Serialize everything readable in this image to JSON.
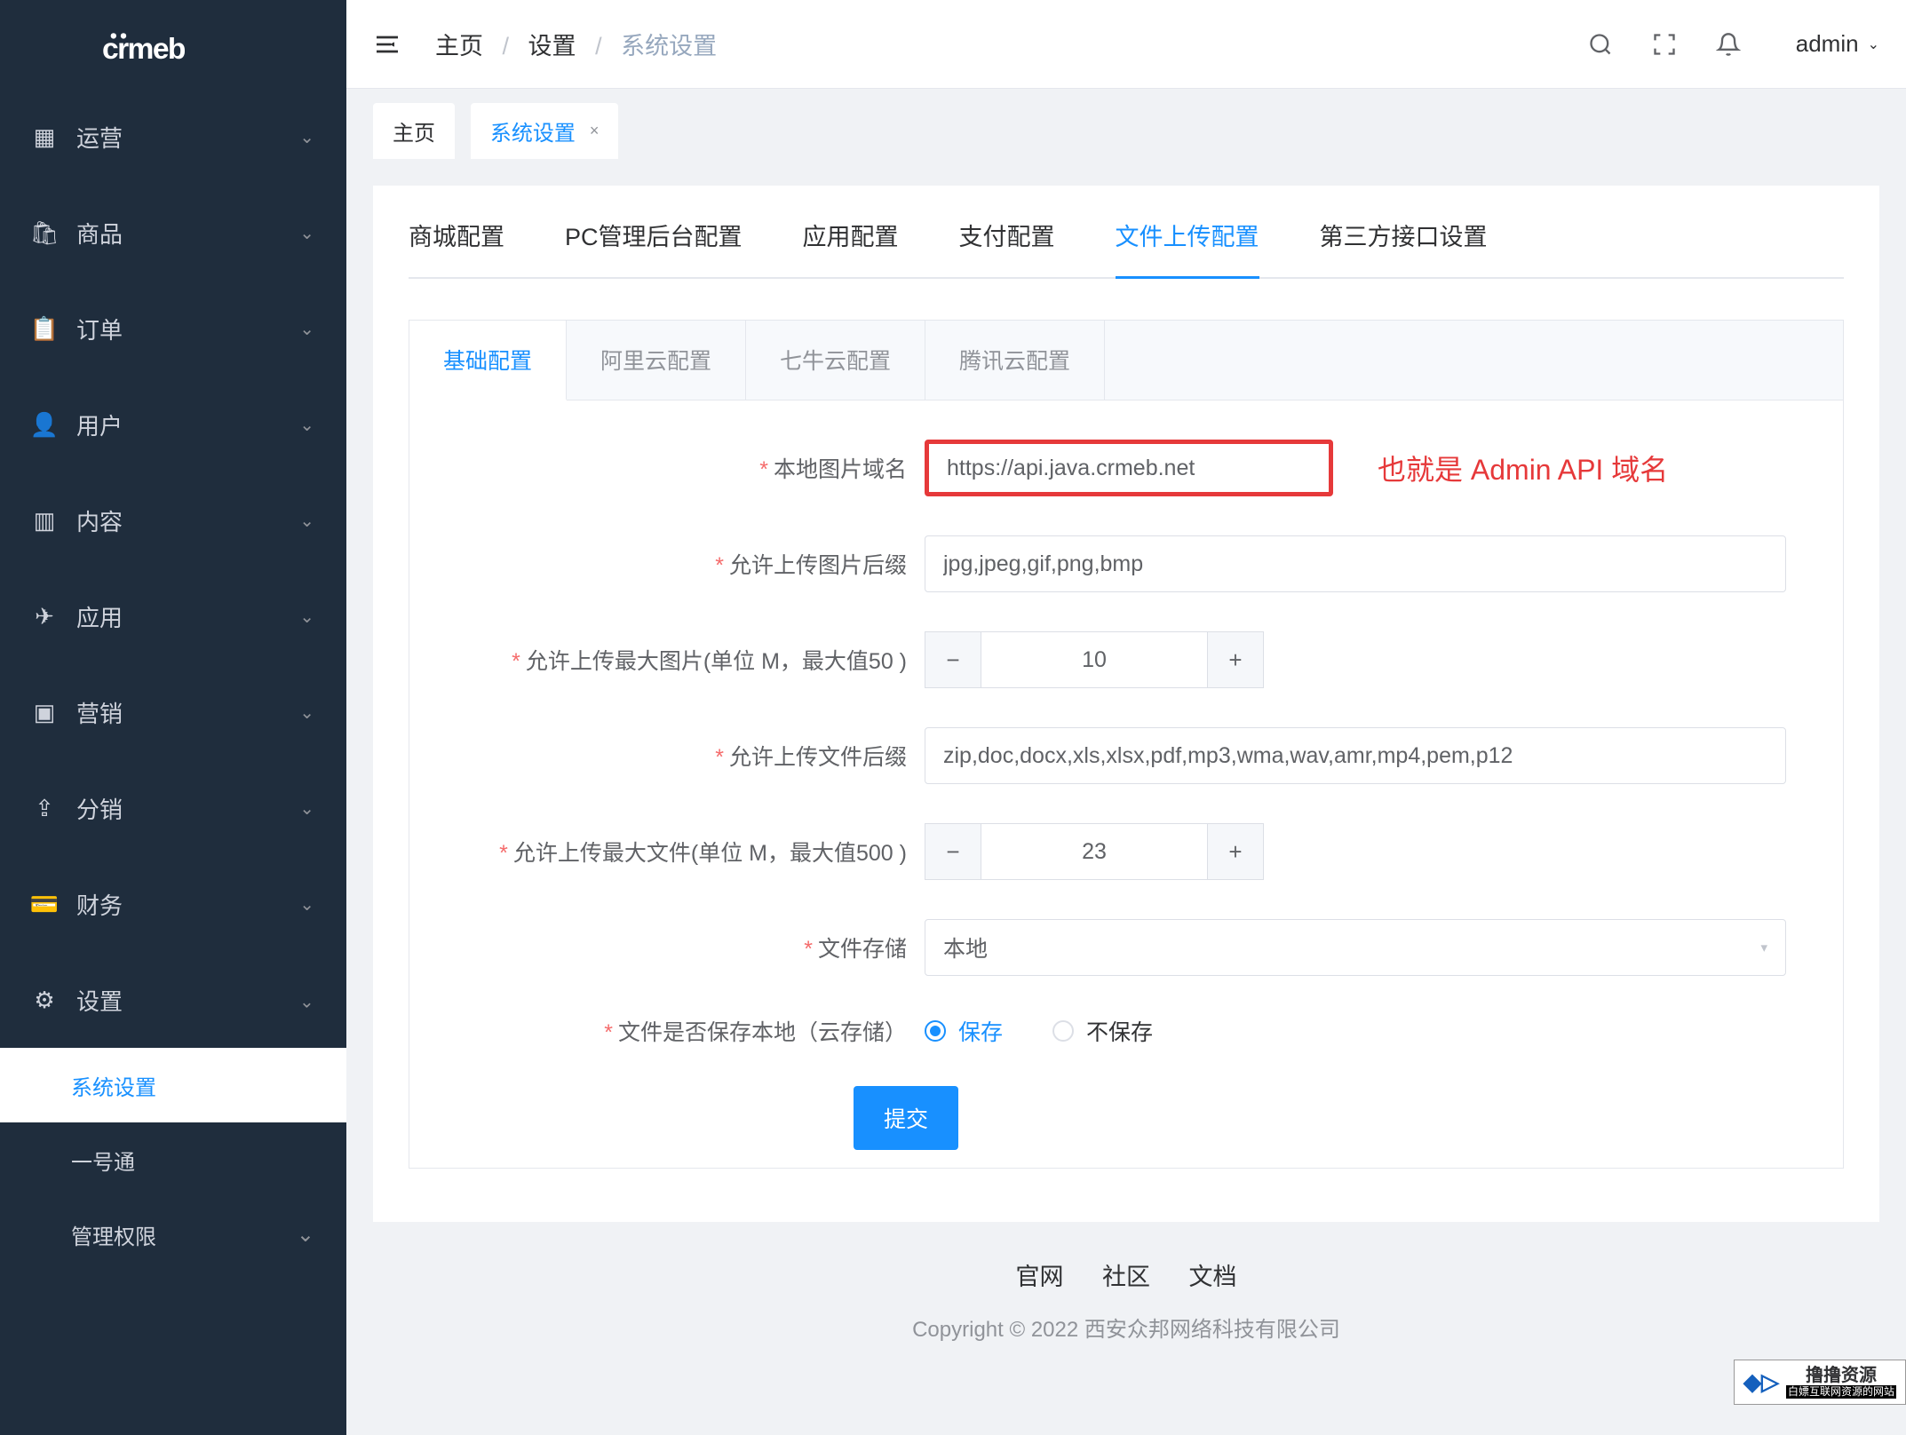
{
  "logo": "crmeb",
  "sidebar": {
    "items": [
      {
        "label": "运营",
        "icon": "grid"
      },
      {
        "label": "商品",
        "icon": "bag"
      },
      {
        "label": "订单",
        "icon": "clipboard"
      },
      {
        "label": "用户",
        "icon": "user"
      },
      {
        "label": "内容",
        "icon": "columns"
      },
      {
        "label": "应用",
        "icon": "plane"
      },
      {
        "label": "营销",
        "icon": "chart"
      },
      {
        "label": "分销",
        "icon": "share"
      },
      {
        "label": "财务",
        "icon": "wallet"
      },
      {
        "label": "设置",
        "icon": "gear",
        "expanded": true
      }
    ],
    "submenu": [
      {
        "label": "系统设置",
        "active": true
      },
      {
        "label": "一号通"
      },
      {
        "label": "管理权限"
      }
    ]
  },
  "header": {
    "breadcrumb": [
      "主页",
      "设置",
      "系统设置"
    ],
    "username": "admin"
  },
  "tabs_bar": [
    {
      "label": "主页"
    },
    {
      "label": "系统设置",
      "active": true,
      "closable": true
    }
  ],
  "main_tabs": [
    "商城配置",
    "PC管理后台配置",
    "应用配置",
    "支付配置",
    "文件上传配置",
    "第三方接口设置"
  ],
  "main_tab_active": 4,
  "sub_tabs": [
    "基础配置",
    "阿里云配置",
    "七牛云配置",
    "腾讯云配置"
  ],
  "sub_tab_active": 0,
  "form": {
    "local_image_domain": {
      "label": "本地图片域名",
      "value": "https://api.java.crmeb.net"
    },
    "annotation": "也就是 Admin API 域名",
    "allowed_image_ext": {
      "label": "允许上传图片后缀",
      "value": "jpg,jpeg,gif,png,bmp"
    },
    "max_image_size": {
      "label": "允许上传最大图片(单位 M，最大值50 )",
      "value": "10"
    },
    "allowed_file_ext": {
      "label": "允许上传文件后缀",
      "value": "zip,doc,docx,xls,xlsx,pdf,mp3,wma,wav,amr,mp4,pem,p12"
    },
    "max_file_size": {
      "label": "允许上传最大文件(单位 M，最大值500 )",
      "value": "23"
    },
    "file_storage": {
      "label": "文件存储",
      "value": "本地"
    },
    "save_local": {
      "label": "文件是否保存本地（云存储）",
      "options": [
        "保存",
        "不保存"
      ],
      "checked": 0
    },
    "submit": "提交"
  },
  "footer": {
    "links": [
      "官网",
      "社区",
      "文档"
    ],
    "copyright": "Copyright © 2022 西安众邦网络科技有限公司"
  },
  "watermark": {
    "brand": "撸撸资源",
    "tag": "白嫖互联网资源的网站"
  }
}
